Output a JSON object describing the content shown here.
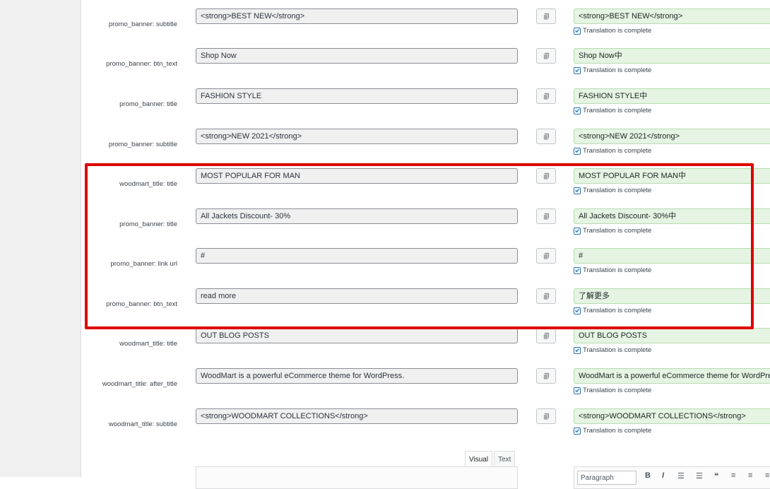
{
  "strings": [
    {
      "label": "promo_banner: subtitle",
      "source": "<strong>BEST NEW</strong>",
      "translation": "<strong>BEST NEW</strong>",
      "status": "Translation is complete"
    },
    {
      "label": "promo_banner: btn_text",
      "source": "Shop Now",
      "translation": "Shop Now中",
      "status": "Translation is complete"
    },
    {
      "label": "promo_banner: title",
      "source": "FASHION STYLE",
      "translation": "FASHION STYLE中",
      "status": "Translation is complete"
    },
    {
      "label": "promo_banner: subtitle",
      "source": "<strong>NEW 2021</strong>",
      "translation": "<strong>NEW 2021</strong>",
      "status": "Translation is complete"
    },
    {
      "label": "woodmart_title: title",
      "source": "MOST POPULAR FOR MAN",
      "translation": "MOST POPULAR FOR MAN中",
      "status": "Translation is complete"
    },
    {
      "label": "promo_banner: title",
      "source": "All Jackets Discount- 30%",
      "translation": "All Jackets Discount- 30%中",
      "status": "Translation is complete"
    },
    {
      "label": "promo_banner: link url",
      "source": "#",
      "translation": "#",
      "status": "Translation is complete"
    },
    {
      "label": "promo_banner: btn_text",
      "source": "read more",
      "translation": "了解更多",
      "status": "Translation is complete"
    },
    {
      "label": "woodmart_title: title",
      "source": "OUT BLOG POSTS",
      "translation": "OUT BLOG POSTS",
      "status": "Translation is complete"
    },
    {
      "label": "woodmart_title: after_title",
      "source": "WoodMart is a powerful eCommerce theme for WordPress.",
      "translation": "WoodMart is a powerful eCommerce theme for WordPress.",
      "status": "Translation is complete"
    },
    {
      "label": "woodmart_title: subtitle",
      "source": "<strong>WOODMART COLLECTIONS</strong>",
      "translation": "<strong>WOODMART COLLECTIONS</strong>",
      "status": "Translation is complete"
    }
  ],
  "editor": {
    "tab_visual": "Visual",
    "tab_text": "Text",
    "format_placeholder": "Paragraph"
  },
  "colors": {
    "highlight": "#e00000",
    "translation_bg": "#e6f4e3",
    "checkbox": "#2271b1"
  }
}
